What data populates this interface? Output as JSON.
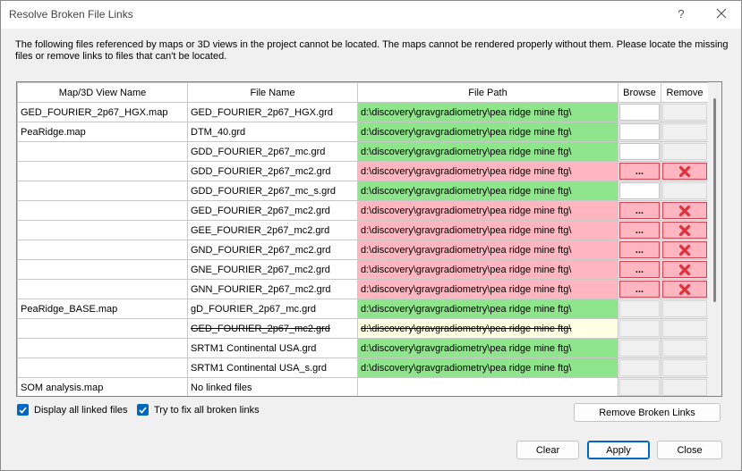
{
  "window": {
    "title": "Resolve Broken File Links",
    "help_label": "?"
  },
  "description": "The following files referenced by maps or 3D views in the project cannot be located. The maps cannot be rendered properly without them. Please locate the missing files or remove links to files that can't be located.",
  "table": {
    "columns": [
      "Map/3D View Name",
      "File Name",
      "File Path",
      "Browse",
      "Remove"
    ],
    "rows": [
      {
        "map": "GED_FOURIER_2p67_HGX.map",
        "file": "GED_FOURIER_2p67_HGX.grd",
        "path": "d:\\discovery\\gravgradiometry\\pea ridge mine ftg\\",
        "status": "ok"
      },
      {
        "map": "PeaRidge.map",
        "file": "DTM_40.grd",
        "path": "d:\\discovery\\gravgradiometry\\pea ridge mine ftg\\",
        "status": "ok"
      },
      {
        "map": "",
        "file": "GDD_FOURIER_2p67_mc.grd",
        "path": "d:\\discovery\\gravgradiometry\\pea ridge mine ftg\\",
        "status": "ok"
      },
      {
        "map": "",
        "file": "GDD_FOURIER_2p67_mc2.grd",
        "path": "d:\\discovery\\gravgradiometry\\pea ridge mine ftg\\",
        "status": "bad"
      },
      {
        "map": "",
        "file": "GDD_FOURIER_2p67_mc_s.grd",
        "path": "d:\\discovery\\gravgradiometry\\pea ridge mine ftg\\",
        "status": "ok"
      },
      {
        "map": "",
        "file": "GED_FOURIER_2p67_mc2.grd",
        "path": "d:\\discovery\\gravgradiometry\\pea ridge mine ftg\\",
        "status": "bad"
      },
      {
        "map": "",
        "file": "GEE_FOURIER_2p67_mc2.grd",
        "path": "d:\\discovery\\gravgradiometry\\pea ridge mine ftg\\",
        "status": "bad"
      },
      {
        "map": "",
        "file": "GND_FOURIER_2p67_mc2.grd",
        "path": "d:\\discovery\\gravgradiometry\\pea ridge mine ftg\\",
        "status": "bad"
      },
      {
        "map": "",
        "file": "GNE_FOURIER_2p67_mc2.grd",
        "path": "d:\\discovery\\gravgradiometry\\pea ridge mine ftg\\",
        "status": "bad"
      },
      {
        "map": "",
        "file": "GNN_FOURIER_2p67_mc2.grd",
        "path": "d:\\discovery\\gravgradiometry\\pea ridge mine ftg\\",
        "status": "bad"
      },
      {
        "map": "PeaRidge_BASE.map",
        "file": "gD_FOURIER_2p67_mc.grd",
        "path": "d:\\discovery\\gravgradiometry\\pea ridge mine ftg\\",
        "status": "ok-grey"
      },
      {
        "map": "",
        "file": "GED_FOURIER_2p67_mc2.grd",
        "path": "d:\\discovery\\gravgradiometry\\pea ridge mine ftg\\",
        "status": "fixed"
      },
      {
        "map": "",
        "file": "SRTM1 Continental USA.grd",
        "path": "d:\\discovery\\gravgradiometry\\pea ridge mine ftg\\",
        "status": "ok-grey"
      },
      {
        "map": "",
        "file": "SRTM1 Continental USA_s.grd",
        "path": "d:\\discovery\\gravgradiometry\\pea ridge mine ftg\\",
        "status": "ok-grey"
      },
      {
        "map": "SOM analysis.map",
        "file": "No linked files",
        "path": "",
        "status": "none"
      }
    ],
    "browse_label": "...",
    "remove_icon": "red-x-icon"
  },
  "options": {
    "display_all_label": "Display all linked files",
    "display_all_checked": true,
    "try_fix_label": "Try to fix all broken links",
    "try_fix_checked": true
  },
  "buttons": {
    "remove_broken": "Remove Broken Links",
    "clear": "Clear",
    "apply": "Apply",
    "close": "Close"
  },
  "colors": {
    "ok": "#8fe58b",
    "bad": "#ffb6c1",
    "fixed": "#ffffe4",
    "accent": "#0067c0",
    "remove_x": "#e0303a"
  }
}
